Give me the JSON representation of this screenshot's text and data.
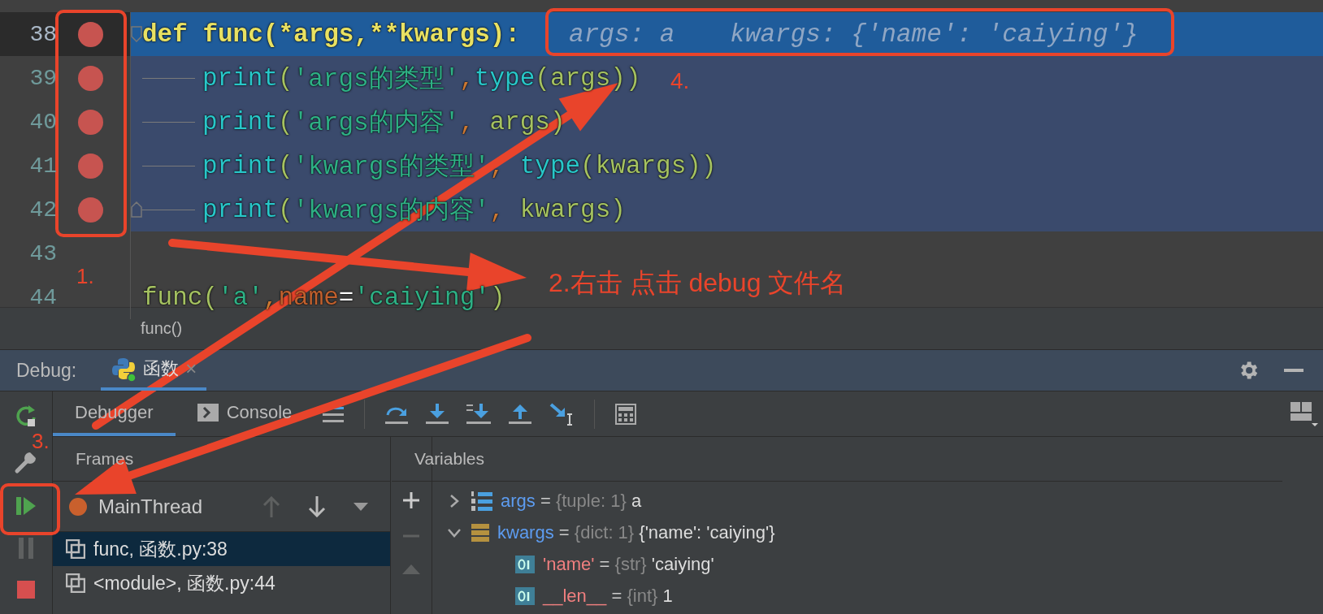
{
  "editor": {
    "lines": [
      {
        "number": "38",
        "current": true,
        "selected": true,
        "breakpoint": true,
        "fold_start": true,
        "fold_end": false,
        "indented": false,
        "tokens": [
          {
            "text": "def func(*args,**kwargs):",
            "kind": "decl"
          }
        ],
        "hints": [
          "args: a",
          "kwargs: {'name': 'caiying'}"
        ]
      },
      {
        "number": "39",
        "current": false,
        "selected": true,
        "breakpoint": true,
        "fold_start": false,
        "fold_end": false,
        "indented": true,
        "tokens": [
          {
            "text": "print",
            "kind": "builtin"
          },
          {
            "text": "(",
            "kind": "paren"
          },
          {
            "text": "'args的类型'",
            "kind": "string"
          },
          {
            "text": ",",
            "kind": "comma"
          },
          {
            "text": "type",
            "kind": "builtin"
          },
          {
            "text": "(args))",
            "kind": "paren"
          }
        ]
      },
      {
        "number": "40",
        "current": false,
        "selected": true,
        "breakpoint": true,
        "fold_start": false,
        "fold_end": false,
        "indented": true,
        "tokens": [
          {
            "text": "print",
            "kind": "builtin"
          },
          {
            "text": "(",
            "kind": "paren"
          },
          {
            "text": "'args的内容'",
            "kind": "string"
          },
          {
            "text": ", ",
            "kind": "comma"
          },
          {
            "text": "args)",
            "kind": "paren"
          }
        ]
      },
      {
        "number": "41",
        "current": false,
        "selected": true,
        "breakpoint": true,
        "fold_start": false,
        "fold_end": false,
        "indented": true,
        "tokens": [
          {
            "text": "print",
            "kind": "builtin"
          },
          {
            "text": "(",
            "kind": "paren"
          },
          {
            "text": "'kwargs的类型'",
            "kind": "string"
          },
          {
            "text": ", ",
            "kind": "comma"
          },
          {
            "text": "type",
            "kind": "builtin"
          },
          {
            "text": "(kwargs))",
            "kind": "paren"
          }
        ]
      },
      {
        "number": "42",
        "current": false,
        "selected": true,
        "breakpoint": true,
        "fold_start": false,
        "fold_end": true,
        "indented": true,
        "tokens": [
          {
            "text": "print",
            "kind": "builtin"
          },
          {
            "text": "(",
            "kind": "paren"
          },
          {
            "text": "'kwargs的内容'",
            "kind": "string"
          },
          {
            "text": ", ",
            "kind": "comma"
          },
          {
            "text": "kwargs)",
            "kind": "paren"
          }
        ]
      },
      {
        "number": "43",
        "current": false,
        "selected": false,
        "breakpoint": false,
        "fold_start": false,
        "fold_end": false,
        "indented": false
      },
      {
        "number": "44",
        "current": false,
        "selected": false,
        "breakpoint": false,
        "fold_start": false,
        "fold_end": false,
        "indented": false,
        "tokens": [
          {
            "text": "func(",
            "kind": "paren"
          },
          {
            "text": "'a'",
            "kind": "string"
          },
          {
            "text": ",",
            "kind": "comma"
          },
          {
            "text": "name",
            "kind": "kwarg"
          },
          {
            "text": "=",
            "kind": "op"
          },
          {
            "text": "'caiying'",
            "kind": "string"
          },
          {
            "text": ")",
            "kind": "paren"
          }
        ]
      }
    ],
    "breadcrumb": "func()"
  },
  "debug": {
    "label": "Debug:",
    "tabs": [
      {
        "label": "函数",
        "selected": true,
        "close": "×"
      }
    ],
    "subtabs": [
      {
        "label": "Debugger",
        "selected": true
      },
      {
        "label": "Console",
        "selected": false
      }
    ],
    "frames": {
      "header": "Frames",
      "thread": "MainThread",
      "items": [
        {
          "label": "func, 函数.py:38",
          "selected": true
        },
        {
          "label": "<module>, 函数.py:44",
          "selected": false
        }
      ]
    },
    "variables": {
      "header": "Variables",
      "items": [
        {
          "name": "args",
          "op": "=",
          "type": "{tuple: 1}",
          "value": "a",
          "kind": "tuple",
          "expanded": false
        },
        {
          "name": "kwargs",
          "op": "=",
          "type": "{dict: 1}",
          "value": "{'name': 'caiying'}",
          "kind": "dict",
          "expanded": true,
          "children": [
            {
              "name": "'name'",
              "op": "=",
              "type": "{str}",
              "value": "'caiying'",
              "kind": "field"
            },
            {
              "name": "__len__",
              "op": "=",
              "type": "{int}",
              "value": "1",
              "kind": "field"
            }
          ]
        }
      ]
    }
  },
  "annotations": {
    "labels": [
      "1.",
      "2.右击 点击 debug 文件名",
      "3.",
      "4."
    ]
  }
}
